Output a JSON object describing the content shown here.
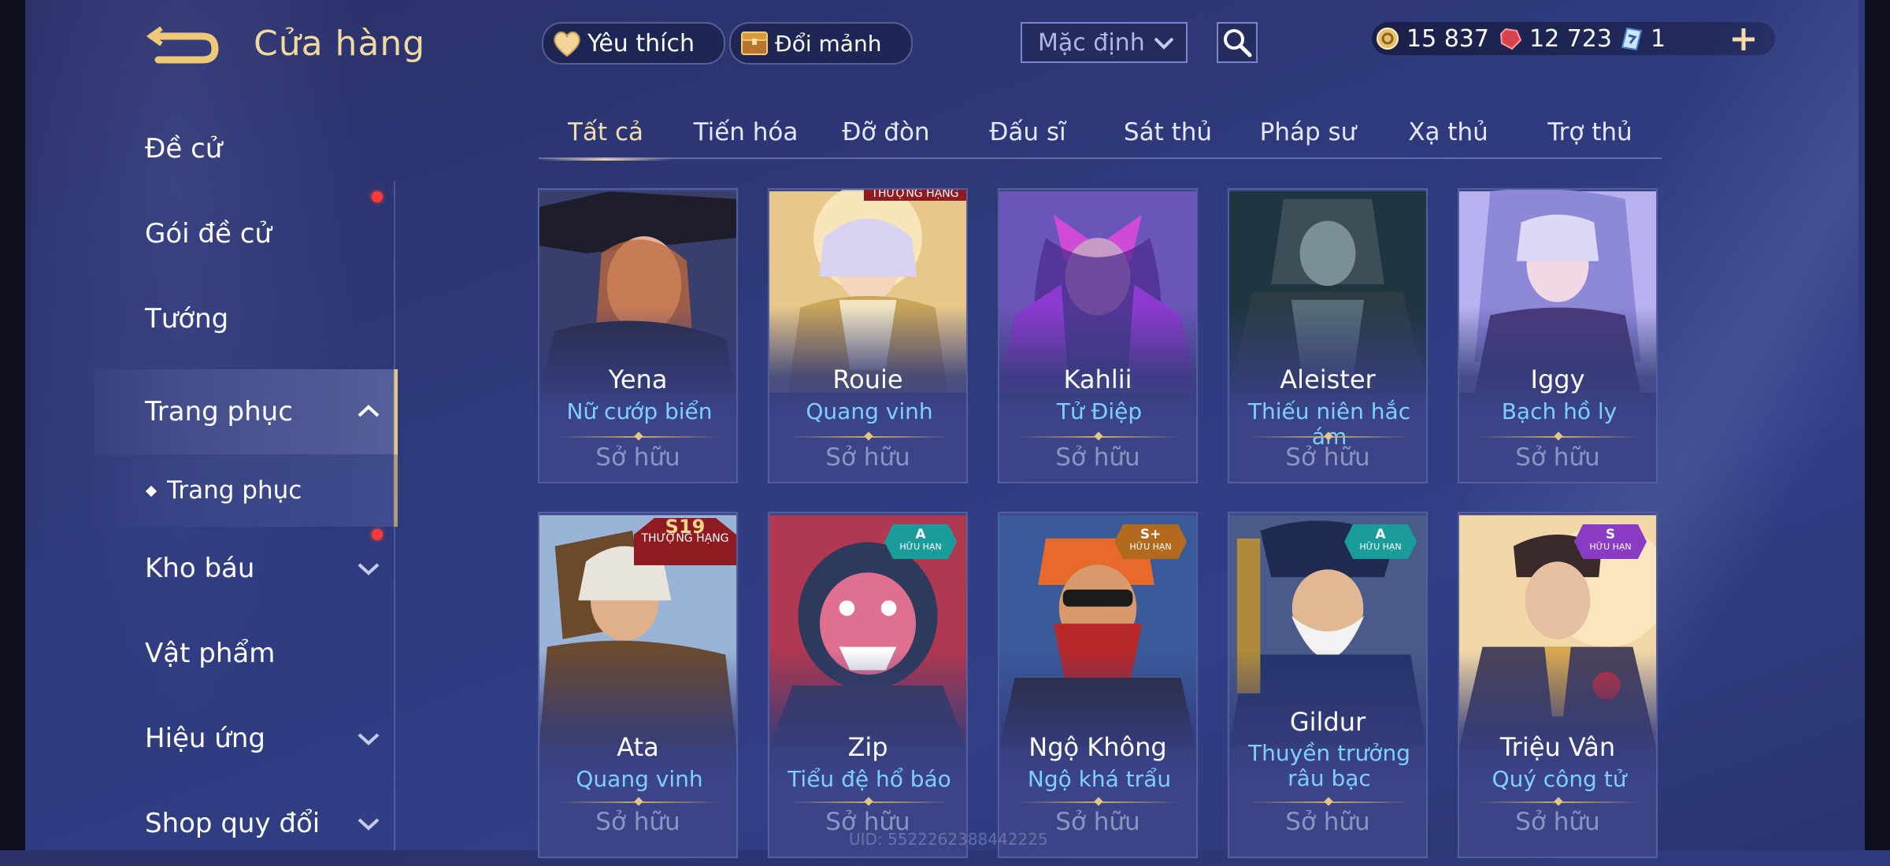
{
  "header": {
    "title": "Cửa hàng",
    "favorite_label": "Yêu thích",
    "shard_label": "Đổi mảnh",
    "sort_value": "Mặc định"
  },
  "currency": {
    "gold": "15 837",
    "gems": "12 723",
    "tickets": "1"
  },
  "sidebar": {
    "items": [
      {
        "label": "Đề cử"
      },
      {
        "label": "Gói đề cử"
      },
      {
        "label": "Tướng"
      },
      {
        "label": "Trang phục"
      },
      {
        "label": "Trang phục"
      },
      {
        "label": "Kho báu"
      },
      {
        "label": "Vật phẩm"
      },
      {
        "label": "Hiệu ứng"
      },
      {
        "label": "Shop quy đổi"
      }
    ]
  },
  "tabs": [
    "Tất cả",
    "Tiến hóa",
    "Đỡ đòn",
    "Đấu sĩ",
    "Sát thủ",
    "Pháp sư",
    "Xạ thủ",
    "Trợ thủ"
  ],
  "cards": [
    {
      "hero": "Yena",
      "skin": "Nữ cướp biển",
      "status": "Sở hữu"
    },
    {
      "hero": "Rouie",
      "skin": "Quang vinh",
      "status": "Sở hữu",
      "badge_text": "THƯỢNG HẠNG"
    },
    {
      "hero": "Kahlii",
      "skin": "Tử Điệp",
      "status": "Sở hữu"
    },
    {
      "hero": "Aleister",
      "skin": "Thiếu niên hắc ám",
      "status": "Sở hữu"
    },
    {
      "hero": "Iggy",
      "skin": "Bạch hồ ly",
      "status": "Sở hữu"
    },
    {
      "hero": "Ata",
      "skin": "Quang vinh",
      "status": "Sở hữu",
      "badge_top": "S19",
      "badge_text": "THƯỢNG HẠNG"
    },
    {
      "hero": "Zip",
      "skin": "Tiểu đệ hổ báo",
      "status": "Sở hữu",
      "tier": "A",
      "tier_sub": "HỮU HẠN"
    },
    {
      "hero": "Ngộ Không",
      "skin": "Ngộ khá trẩu",
      "status": "Sở hữu",
      "tier": "S+",
      "tier_sub": "HỮU HẠN"
    },
    {
      "hero": "Gildur",
      "skin": "Thuyền trưởng râu bạc",
      "status": "Sở hữu",
      "tier": "A",
      "tier_sub": "HỮU HẠN"
    },
    {
      "hero": "Triệu Vân",
      "skin": "Quý công tử",
      "status": "Sở hữu",
      "tier": "S",
      "tier_sub": "HỮU HẠN"
    }
  ],
  "footer": {
    "uid": "UID: 5522262388442225"
  },
  "colors": {
    "accent_gold": "#f2d9a0",
    "skin_name": "#7fd0ff",
    "tier_a": "#1a9c9a",
    "tier_s_plus": "#b26a1e",
    "tier_s": "#8a3bc4",
    "badge_red": "#8e1b22"
  },
  "icons": [
    "back-arrow-icon",
    "heart-icon",
    "shard-chest-icon",
    "chevron-down-icon",
    "search-icon",
    "gold-coin-icon",
    "ruby-gem-icon",
    "ticket-icon",
    "plus-icon",
    "chevron-up-icon"
  ]
}
